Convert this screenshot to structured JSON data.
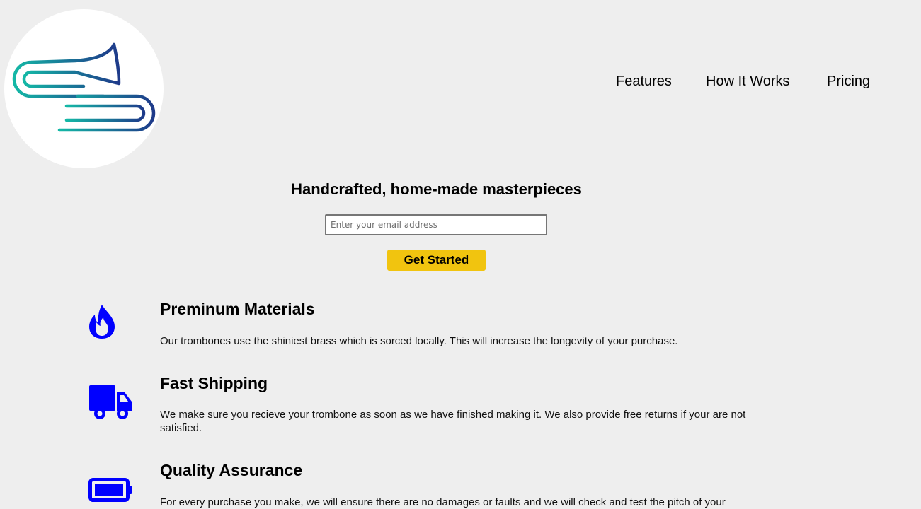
{
  "brand": {
    "logo_icon": "trombone-logo-icon"
  },
  "nav": {
    "items": [
      {
        "label": "Features"
      },
      {
        "label": "How It Works"
      },
      {
        "label": "Pricing"
      }
    ]
  },
  "hero": {
    "title": "Handcrafted, home-made masterpieces",
    "email_placeholder": "Enter your email address",
    "email_value": "",
    "cta_label": "Get Started"
  },
  "features": [
    {
      "icon": "fire-icon",
      "title": "Preminum Materials",
      "description": "Our trombones use the shiniest brass which is sorced locally. This will increase the longevity of your purchase."
    },
    {
      "icon": "truck-icon",
      "title": "Fast Shipping",
      "description": "We make sure you recieve your trombone as soon as we have finished making it. We also provide free returns if your are not satisfied."
    },
    {
      "icon": "battery-icon",
      "title": "Quality Assurance",
      "description": "For every purchase you make, we will ensure there are no damages or faults and we will check and test the pitch of your"
    }
  ],
  "colors": {
    "page_background": "#eeeeee",
    "cta_background": "#f1c40f",
    "icon_blue": "#0000ff",
    "logo_gradient_start": "#14b8a6",
    "logo_gradient_end": "#1e3a8a"
  }
}
